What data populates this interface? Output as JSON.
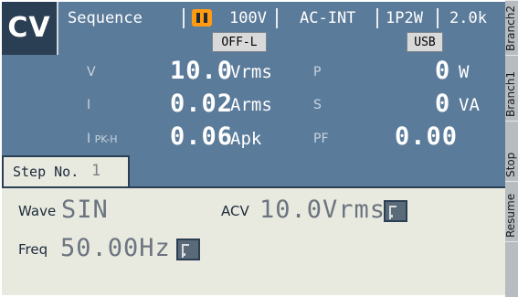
{
  "header": {
    "mode": "CV",
    "function": "Sequence",
    "range": "100V",
    "source": "AC-INT",
    "wiring": "1P2W",
    "extra": "2.0k",
    "output_state": "OFF-L",
    "interface": "USB",
    "pause_icon": "pause-icon",
    "accent_color": "#ff9a12"
  },
  "measurements": {
    "v_label": "V",
    "v_value": "10.0",
    "v_unit": "Vrms",
    "i_label": "I",
    "i_value": "0.02",
    "i_unit": "Arms",
    "ipk_label": "I",
    "ipk_sub": "PK-H",
    "ipk_value": "0.06",
    "ipk_unit": "Apk",
    "p_label": "P",
    "p_value": "0",
    "p_unit": "W",
    "s_label": "S",
    "s_value": "0",
    "s_unit": "VA",
    "pf_label": "PF",
    "pf_value": "0.00"
  },
  "step": {
    "label": "Step No.",
    "number": "1"
  },
  "settings": {
    "wave_label": "Wave",
    "wave_value": "SIN",
    "acv_label": "ACV",
    "acv_value": "10.0Vrms",
    "freq_label": "Freq",
    "freq_value": "50.00Hz"
  },
  "side_tabs": [
    "Branch2",
    "Branch1",
    "Stop",
    "Resume"
  ],
  "colors": {
    "background": "#5b7b9a",
    "panel": "#e9eadf",
    "dark": "#2b3f54"
  }
}
